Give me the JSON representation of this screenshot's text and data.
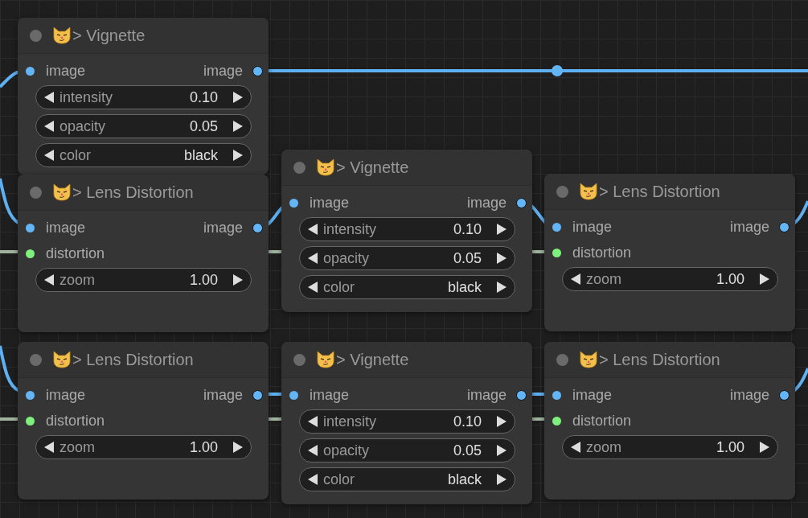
{
  "nodes": [
    {
      "kind": "vignette",
      "title": "> Vignette",
      "inputs": [
        {
          "name": "image",
          "color": "#64b5f6"
        }
      ],
      "outputs": [
        {
          "name": "image",
          "color": "#64b5f6"
        }
      ],
      "widgets": [
        {
          "label": "intensity",
          "value": "0.10"
        },
        {
          "label": "opacity",
          "value": "0.05"
        },
        {
          "label": "color",
          "value": "black"
        }
      ]
    },
    {
      "kind": "lens",
      "title": "> Lens Distortion",
      "inputs": [
        {
          "name": "image",
          "color": "#64b5f6"
        },
        {
          "name": "distortion",
          "color": "#7ef07e"
        }
      ],
      "outputs": [
        {
          "name": "image",
          "color": "#64b5f6"
        }
      ],
      "widgets": [
        {
          "label": "zoom",
          "value": "1.00"
        }
      ]
    },
    {
      "kind": "vignette",
      "title": "> Vignette",
      "inputs": [
        {
          "name": "image",
          "color": "#64b5f6"
        }
      ],
      "outputs": [
        {
          "name": "image",
          "color": "#64b5f6"
        }
      ],
      "widgets": [
        {
          "label": "intensity",
          "value": "0.10"
        },
        {
          "label": "opacity",
          "value": "0.05"
        },
        {
          "label": "color",
          "value": "black"
        }
      ]
    },
    {
      "kind": "lens",
      "title": "> Lens Distortion",
      "inputs": [
        {
          "name": "image",
          "color": "#64b5f6"
        },
        {
          "name": "distortion",
          "color": "#7ef07e"
        }
      ],
      "outputs": [
        {
          "name": "image",
          "color": "#64b5f6"
        }
      ],
      "widgets": [
        {
          "label": "zoom",
          "value": "1.00"
        }
      ]
    },
    {
      "kind": "lens",
      "title": "> Lens Distortion",
      "inputs": [
        {
          "name": "image",
          "color": "#64b5f6"
        },
        {
          "name": "distortion",
          "color": "#7ef07e"
        }
      ],
      "outputs": [
        {
          "name": "image",
          "color": "#64b5f6"
        }
      ],
      "widgets": [
        {
          "label": "zoom",
          "value": "1.00"
        }
      ]
    },
    {
      "kind": "vignette",
      "title": "> Vignette",
      "inputs": [
        {
          "name": "image",
          "color": "#64b5f6"
        }
      ],
      "outputs": [
        {
          "name": "image",
          "color": "#64b5f6"
        }
      ],
      "widgets": [
        {
          "label": "intensity",
          "value": "0.10"
        },
        {
          "label": "opacity",
          "value": "0.05"
        },
        {
          "label": "color",
          "value": "black"
        }
      ]
    },
    {
      "kind": "lens",
      "title": "> Lens Distortion",
      "inputs": [
        {
          "name": "image",
          "color": "#64b5f6"
        },
        {
          "name": "distortion",
          "color": "#7ef07e"
        }
      ],
      "outputs": [
        {
          "name": "image",
          "color": "#64b5f6"
        }
      ],
      "widgets": [
        {
          "label": "zoom",
          "value": "1.00"
        }
      ]
    }
  ]
}
